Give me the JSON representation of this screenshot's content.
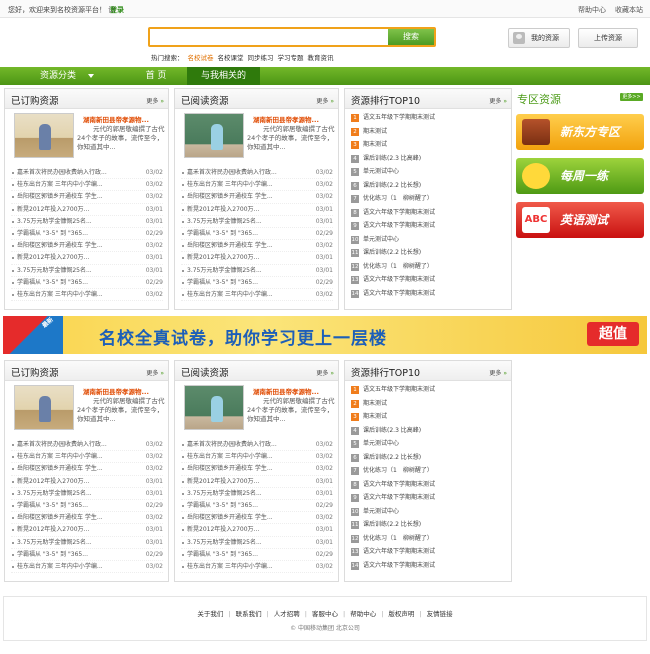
{
  "topbar": {
    "welcome": "您好，欢迎来到名校资源平台！ 请",
    "login": "登录",
    "help": "帮助中心",
    "favorite": "收藏本站"
  },
  "search": {
    "placeholder": "",
    "button": "搜索",
    "hot_label": "热门搜索：",
    "hot_terms": [
      "名校试卷",
      "名校课堂",
      "同步练习",
      "学习专题",
      "教育资讯"
    ]
  },
  "header_buttons": {
    "my_resources": "我的资源",
    "upload": "上传资源"
  },
  "nav": {
    "category": "资源分类",
    "home": "首 页",
    "related": "与我相关的"
  },
  "more": "更多",
  "featured": {
    "title": "湖南新田县帝孝源物...",
    "desc": "元代的郭居敬编撰了古代24个孝子的故事，流传至今，你知道其中..."
  },
  "featured_b": {
    "title": "湖南新田县帝孝源物...",
    "desc": "元代的郭居敬编撰了古代24个孝子的故事，流传至今，你知道其中..."
  },
  "sections": {
    "purchased": "已订购资源",
    "read": "已阅读资源",
    "ranking": "资源排行TOP10",
    "special": "专区资源",
    "special_more": "更多>>"
  },
  "list_a": [
    {
      "t": "嘉禾首次将民办园收费纳入行政...",
      "d": "03/02"
    },
    {
      "t": "桂东出台方案 三年内中小学编...",
      "d": "03/02"
    },
    {
      "t": "岳阳楼区郭镇乡开通校车 学生...",
      "d": "03/02"
    },
    {
      "t": "新晃2012年投入2700万...",
      "d": "03/01"
    },
    {
      "t": "3.75万元助学金慷慨25名...",
      "d": "03/01"
    },
    {
      "t": "学霸福从 \"3-5\" 到 \"365...",
      "d": "02/29"
    },
    {
      "t": "岳阳楼区郭镇乡开通校车 学生...",
      "d": "03/02"
    },
    {
      "t": "新晃2012年投入2700万...",
      "d": "03/01"
    },
    {
      "t": "3.75万元助学金慷慨25名...",
      "d": "03/01"
    },
    {
      "t": "学霸福从 \"3-5\" 到 \"365...",
      "d": "02/29"
    },
    {
      "t": "桂东出台方案 三年内中小学编...",
      "d": "03/02"
    }
  ],
  "ranking_list": [
    "语文五年级下学期期末测试",
    "期末测试",
    "期末测试",
    "课后训练(2.3 比高峰)",
    "单元测试中心",
    "课后训练(2.2 比长想)",
    "优化练习（1　柳树醒了）",
    "语文六年级下学期期末测试",
    "语文六年级下学期期末测试",
    "单元测试中心",
    "课后训练(2.2 比长想)",
    "优化练习（1　柳树醒了）",
    "语文六年级下学期期末测试",
    "语文六年级下学期期末测试"
  ],
  "promos": [
    "新东方专区",
    "每周一练",
    "英语测试"
  ],
  "banner": {
    "tag": "最新",
    "slogan": "名校全真试卷，助你学习更上一层楼",
    "deal": "超值"
  },
  "footer": {
    "links": [
      "关于我们",
      "联系我们",
      "人才招聘",
      "客服中心",
      "帮助中心",
      "版权声明",
      "友情链接"
    ],
    "copyright": "© 中国移动集团 北京公司"
  }
}
